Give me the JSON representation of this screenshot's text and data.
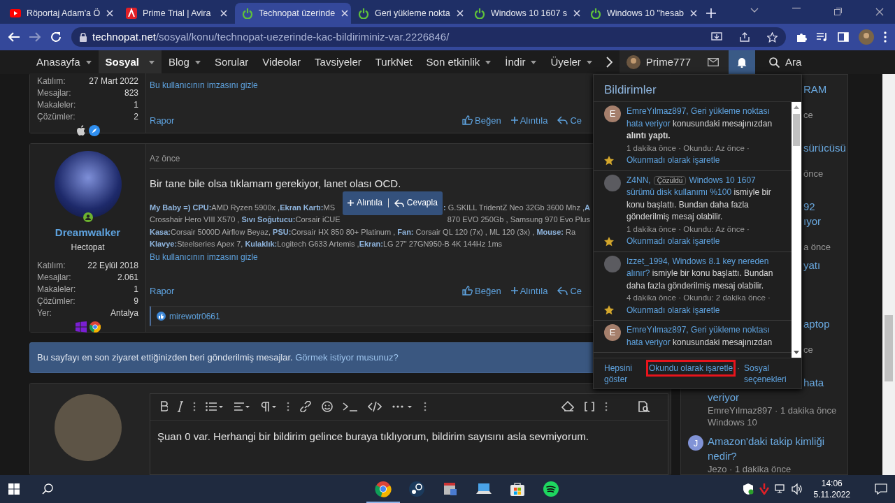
{
  "browser": {
    "tabs": [
      {
        "title": "Röportaj Adam'a Ö",
        "selected": false
      },
      {
        "title": "Prime Trial | Avira",
        "selected": false
      },
      {
        "title": "Technopat üzerinde",
        "selected": true
      },
      {
        "title": "Geri yükleme nokta",
        "selected": false
      },
      {
        "title": "Windows 10 1607 s",
        "selected": false
      },
      {
        "title": "Windows 10 \"hesab",
        "selected": false
      }
    ],
    "url": {
      "host": "technopat.net",
      "path": "/sosyal/konu/technopat-uezerinde-kac-bildiriminiz-var.2226846/"
    }
  },
  "site_nav": {
    "items": [
      {
        "label": "Anasayfa",
        "selected": false,
        "dropdown": true
      },
      {
        "label": "Sosyal",
        "selected": true,
        "dropdown": true
      },
      {
        "label": "Blog",
        "selected": false,
        "dropdown": true
      },
      {
        "label": "Sorular",
        "selected": false,
        "dropdown": false
      },
      {
        "label": "Videolar",
        "selected": false,
        "dropdown": false
      },
      {
        "label": "Tavsiyeler",
        "selected": false,
        "dropdown": false
      },
      {
        "label": "TurkNet",
        "selected": false,
        "dropdown": false
      },
      {
        "label": "Son etkinlik",
        "selected": false,
        "dropdown": true
      },
      {
        "label": "İndir",
        "selected": false,
        "dropdown": true
      },
      {
        "label": "Üyeler",
        "selected": false,
        "dropdown": true
      }
    ],
    "user": "Prime777",
    "search": "Ara"
  },
  "posts": [
    {
      "stats": [
        {
          "label": "Katılım:",
          "value": "27 Mart 2022"
        },
        {
          "label": "Mesajlar:",
          "value": "823"
        },
        {
          "label": "Makaleler:",
          "value": "1"
        },
        {
          "label": "Çözümler:",
          "value": "2"
        }
      ],
      "signature_toggle": "Bu kullanıcının imzasını gizle",
      "actions": {
        "report": "Rapor",
        "like": "Beğen",
        "quote": "Alıntıla",
        "reply": "Ce"
      }
    },
    {
      "username": "Dreamwalker",
      "title": "Hectopat",
      "online": true,
      "stats": [
        {
          "label": "Katılım:",
          "value": "22 Eylül 2018"
        },
        {
          "label": "Mesajlar:",
          "value": "2.061"
        },
        {
          "label": "Makaleler:",
          "value": "1"
        },
        {
          "label": "Çözümler:",
          "value": "9"
        },
        {
          "label": "Yer:",
          "value": "Antalya"
        }
      ],
      "date": "Az önce",
      "message": "Bir tane bile olsa tıklamam gerekiyor, lanet olası OCD.",
      "signature_lines": [
        [
          "**My Baby =)** **CPU:**AMD Ryzen 5900x ,**Ekran Kartı:**MS",
          "**:** G.SKILL TridentZ Neo 32Gb 3600 Mhz ,**A**"
        ],
        [
          "Crosshair Hero VIII X570 , **Sıvı Soğutucu:**Corsair iCUE",
          "870 EVO 250Gb , Samsung 970 Evo Plus"
        ],
        [
          "**Kasa:**Corsair 5000D Airflow Beyaz, **PSU:**Corsair HX 850 80+ Platinum , **Fan:** Corsair QL 120 (7x) , ML 120 (3x) , **Mouse:** Ra"
        ],
        [
          "**Klavye:**Steelseries Apex 7, **Kulaklık:**Logitech G633 Artemis ,**Ekran:**LG 27\" 27GN950-B 4K 144Hz 1ms"
        ]
      ],
      "signature_toggle": "Bu kullanıcının imzasını gizle",
      "quote_popup": {
        "quote": "Alıntıla",
        "reply": "Cevapla"
      },
      "actions": {
        "report": "Rapor",
        "like": "Beğen",
        "quote": "Alıntıla",
        "reply": "Ce"
      },
      "likes": "mirewotr0661"
    }
  ],
  "notice": {
    "text": "Bu sayfayı en son ziyaret ettiğinizden beri gönderilmiş mesajlar.",
    "link": "Görmek istiyor musunuz?"
  },
  "editor": {
    "text": "Şuan 0 var. Herhangi bir bildirim gelince buraya tıklıyorum, bildirim sayısını asla sevmiyorum."
  },
  "notifications": {
    "title": "Bildirimler",
    "items": [
      {
        "avatar": {
          "kind": "letter",
          "letter": "E",
          "color": "#a57f6c"
        },
        "parts": [
          {
            "text": "EmreYılmaz897, Geri yükleme noktası hata veriyor",
            "kind": "link"
          },
          {
            "text": " konusundaki mesajınızdan ",
            "kind": "plain"
          },
          {
            "text": "alıntı yaptı.",
            "kind": "bold"
          }
        ],
        "meta": "1 dakika önce · Okundu: Az önce ·",
        "action": "Okunmadı olarak işaretle"
      },
      {
        "avatar": {
          "kind": "photo"
        },
        "parts": [
          {
            "text": "Z4NN,",
            "kind": "link"
          },
          {
            "text": "Çözüldü",
            "kind": "badge"
          },
          {
            "text": "Windows 10 1607 sürümü disk kullanımı %100",
            "kind": "link"
          },
          {
            "text": " ismiyle bir konu başlattı. Bundan daha fazla gönderilmiş mesaj olabilir.",
            "kind": "plain"
          }
        ],
        "meta": "1 dakika önce · Okundu: Az önce ·",
        "action": "Okunmadı olarak işaretle"
      },
      {
        "avatar": {
          "kind": "photo"
        },
        "parts": [
          {
            "text": "Izzet_1994, Windows 8.1 key nereden alınır?",
            "kind": "link"
          },
          {
            "text": " ismiyle bir konu başlattı. Bundan daha fazla gönderilmiş mesaj olabilir.",
            "kind": "plain"
          }
        ],
        "meta": "4 dakika önce · Okundu: 2 dakika önce ·",
        "action": "Okunmadı olarak işaretle"
      },
      {
        "avatar": {
          "kind": "letter",
          "letter": "E",
          "color": "#a57f6c"
        },
        "parts": [
          {
            "text": "EmreYılmaz897, Geri yükleme noktası hata veriyor",
            "kind": "link"
          },
          {
            "text": " konusundaki mesajınızdan",
            "kind": "plain"
          }
        ]
      }
    ],
    "footer": [
      {
        "label": "Hepsini göster"
      },
      {
        "label": "Okundu olarak işaretle",
        "highlighted": true
      },
      {
        "label": "Sosyal seçenekleri"
      }
    ],
    "separator": "·"
  },
  "sidebar": {
    "items": [
      {
        "fragments": [
          "RAM"
        ],
        "meta": "ce"
      },
      {
        "fragments": [
          "sürücüsü"
        ],
        "meta": "önce"
      },
      {
        "fragments": [
          "92",
          "ıyor"
        ],
        "meta": "a önce"
      },
      {
        "fragments": [
          "yatı"
        ]
      },
      {
        "fragments": [
          "aptop"
        ],
        "meta": "ce"
      },
      {
        "fragments": [
          "hata"
        ],
        "title": "veriyor",
        "meta": "EmreYılmaz897 · 1 dakika önce",
        "forum": "Windows 10"
      },
      {
        "avatar": {
          "letter": "J",
          "color": "#8193d6"
        },
        "title": "Amazon'daki takip kimliği nedir?",
        "meta": "Jezo · 1 dakika önce"
      }
    ]
  },
  "taskbar": {
    "time": "14:06",
    "date": "5.11.2022"
  }
}
